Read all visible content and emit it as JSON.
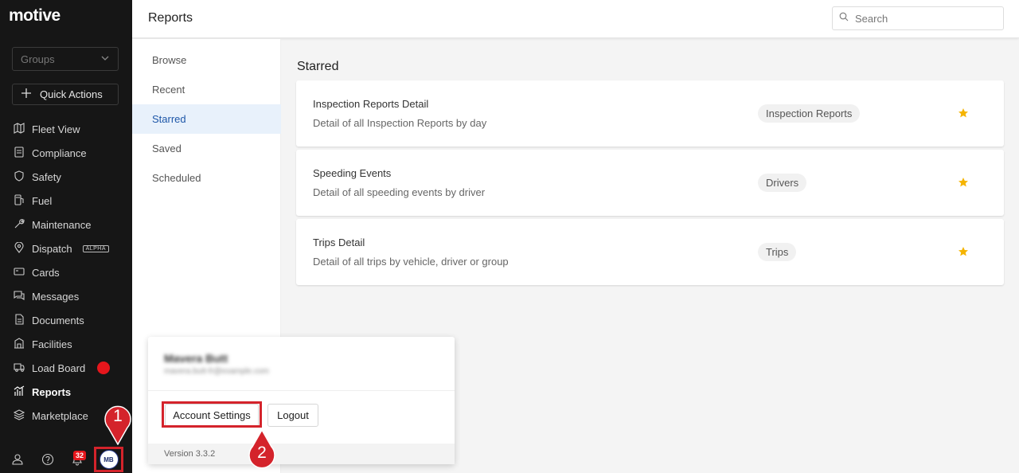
{
  "brand": {
    "logo_text": "motive"
  },
  "sidebar": {
    "groups_label": "Groups",
    "quick_actions_label": "Quick Actions",
    "items": [
      {
        "label": "Fleet View",
        "icon": "map-icon"
      },
      {
        "label": "Compliance",
        "icon": "list-icon"
      },
      {
        "label": "Safety",
        "icon": "shield-icon"
      },
      {
        "label": "Fuel",
        "icon": "fuel-icon"
      },
      {
        "label": "Maintenance",
        "icon": "wrench-icon"
      },
      {
        "label": "Dispatch",
        "icon": "location-icon",
        "tag": "ALPHA"
      },
      {
        "label": "Cards",
        "icon": "card-icon"
      },
      {
        "label": "Messages",
        "icon": "chat-icon"
      },
      {
        "label": "Documents",
        "icon": "document-icon"
      },
      {
        "label": "Facilities",
        "icon": "building-icon"
      },
      {
        "label": "Load Board",
        "icon": "truck-icon"
      },
      {
        "label": "Reports",
        "icon": "chart-icon",
        "active": true
      },
      {
        "label": "Marketplace",
        "icon": "layers-icon"
      }
    ],
    "notification_count": "32",
    "avatar_initials": "MB"
  },
  "header": {
    "title": "Reports",
    "search_placeholder": "Search"
  },
  "subnav": {
    "items": [
      "Browse",
      "Recent",
      "Starred",
      "Saved",
      "Scheduled"
    ],
    "active": "Starred"
  },
  "main": {
    "section_title": "Starred",
    "reports": [
      {
        "title": "Inspection Reports Detail",
        "description": "Detail of all Inspection Reports by day",
        "category": "Inspection Reports"
      },
      {
        "title": "Speeding Events",
        "description": "Detail of all speeding events by driver",
        "category": "Drivers"
      },
      {
        "title": "Trips Detail",
        "description": "Detail of all trips by vehicle, driver or group",
        "category": "Trips"
      }
    ]
  },
  "popup": {
    "name": "Mavera Butt",
    "email": "mavera.butt-fr@example.com",
    "account_settings_label": "Account Settings",
    "logout_label": "Logout",
    "version": "Version 3.3.2"
  },
  "callouts": {
    "step1": "1",
    "step2": "2"
  },
  "colors": {
    "sidebar_bg": "#161616",
    "accent_red": "#d4232b",
    "active_blue": "#1e57a8",
    "star": "#f5b400"
  }
}
